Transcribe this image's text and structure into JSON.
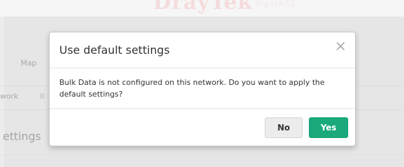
{
  "background": {
    "logo": "DrayTek",
    "logo_tail": "VigorACS",
    "map_tab": "Map",
    "network_tab": "work",
    "tab_mark": "II",
    "settings_heading": "ettings"
  },
  "dialog": {
    "title": "Use default settings",
    "close_icon": "close-icon",
    "message": "Bulk Data is not configured on this network. Do you want to apply the default settings?",
    "no_label": "No",
    "yes_label": "Yes"
  },
  "colors": {
    "primary": "#19a97c",
    "secondary_button": "#ececec",
    "backdrop": "#e6e6e6",
    "logo": "#f5dcdc"
  }
}
